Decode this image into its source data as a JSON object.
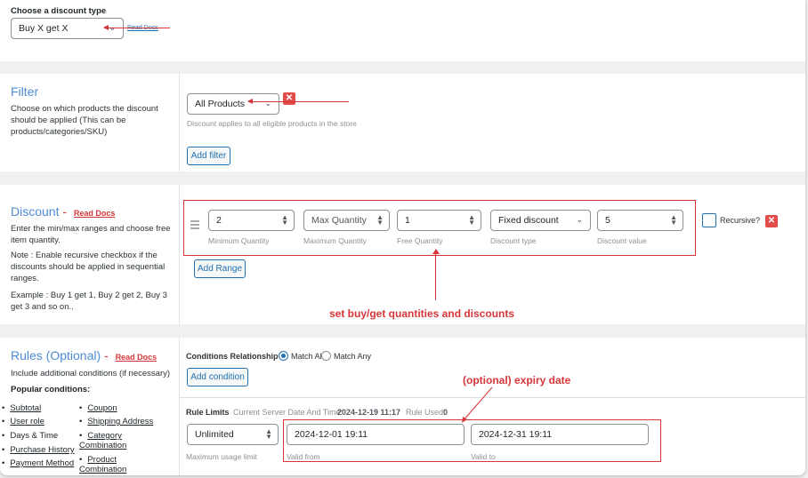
{
  "discount_type": {
    "label": "Choose a discount type",
    "value": "Buy X get X",
    "read_docs": "Read Docs"
  },
  "filter": {
    "title": "Filter",
    "description": "Choose on which products the discount should be applied (This can be products/categories/SKU)",
    "select_value": "All Products",
    "hint": "Discount applies to all eligible products in the store",
    "add_filter": "Add filter"
  },
  "discount": {
    "title": "Discount",
    "dash": " - ",
    "read_docs": "Read Docs",
    "desc1": "Enter the min/max ranges and choose free item quantity.",
    "desc2": "Note : Enable recursive checkbox if the discounts should be applied in sequential ranges.",
    "desc3": "Example : Buy 1 get 1, Buy 2 get 2, Buy 3 get 3 and so on..",
    "min_qty_value": "2",
    "min_qty_label": "Minimum Quantity",
    "max_qty_value": "Max Quantity",
    "max_qty_label": "Maximum Quantity",
    "free_qty_value": "1",
    "free_qty_label": "Free Quantity",
    "discount_type_value": "Fixed discount",
    "discount_type_label": "Discount type",
    "discount_value": "5",
    "discount_value_label": "Discount value",
    "recursive_label": "Recursive?",
    "add_range": "Add Range",
    "annotation": "set buy/get quantities and discounts"
  },
  "rules": {
    "title": "Rules (Optional)",
    "dash": " - ",
    "read_docs": "Read Docs",
    "description": "Include additional conditions (if necessary)",
    "popular_heading": "Popular conditions:",
    "conditions_left": [
      "Subtotal",
      "User role",
      "Days & Time",
      "Purchase History",
      "Payment Method"
    ],
    "conditions_right": [
      "Coupon",
      "Shipping Address",
      "Category Combination",
      "Product Combination"
    ],
    "relationship_label": "Conditions Relationship",
    "match_all": "Match All",
    "match_any": "Match Any",
    "add_condition": "Add condition",
    "expiry_annotation": "(optional) expiry date",
    "limits_label": "Rule Limits",
    "server_time_label": "Current Server Date And Time:",
    "server_time_value": "2024-12-19 11:17",
    "rule_used_label": "Rule Used:",
    "rule_used_value": "0",
    "usage_value": "Unlimited",
    "usage_label": "Maximum usage limit",
    "valid_from_value": "2024-12-01 19:11",
    "valid_from_label": "Valid from",
    "valid_to_value": "2024-12-31 19:11",
    "valid_to_label": "Valid to"
  },
  "colors": {
    "accent_blue": "#4e8bd5",
    "annotation_red": "#d63638",
    "button_blue": "#2271b1"
  }
}
